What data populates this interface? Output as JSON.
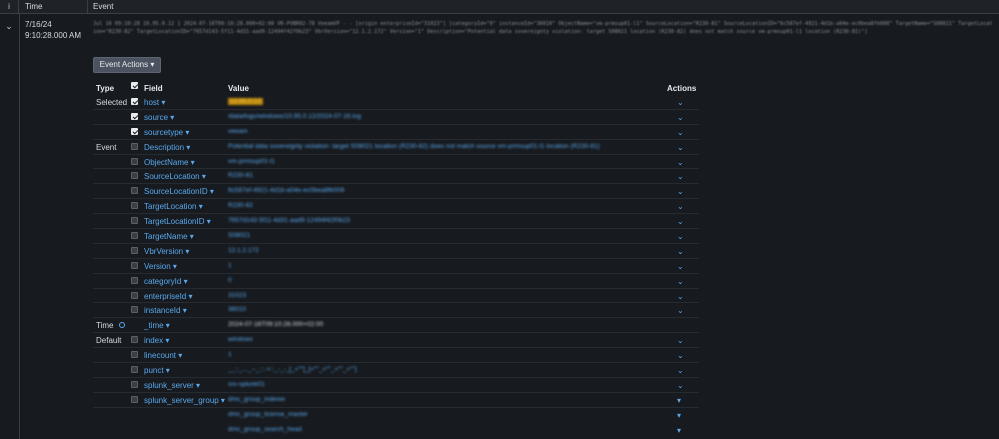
{
  "header": {
    "info_label": "i",
    "time_label": "Time",
    "event_label": "Event"
  },
  "event": {
    "date": "7/16/24",
    "time": "9:10:28.000 AM",
    "raw_text": "Jul 16 09:10:28 10.95.0.12 1 2024-07-16T09:10:28.000+02:00 VR-PVBR02-78 VeeamVP - - [origin enterpriseId=\"31023\"] [categoryId=\"0\" instanceId=\"36010\" ObjectName=\"vm-prmsup01-l1\" SourceLocation=\"R230-81\" SourceLocationID=\"6c587ef-4921-4d1b-a04e-ec0bea8fb008\" TargetName=\"S08021\" TargetLocation=\"R230-82\" TargetLocationID=\"7657d143-5f11-4d31-aad9-12494f42f0b23\" VbrVersion=\"12.1.2.172\" Version=\"1\" Description=\"Potential data sovereignty violation: target S08021 location (R230-82) does not match source vm-prmsup01-l1 location (R230-81)\"]",
    "actions_button": "Event Actions ▾"
  },
  "table": {
    "col_type": "Type",
    "col_field": "Field",
    "col_value": "Value",
    "col_actions": "Actions",
    "rows": [
      {
        "group": "Selected",
        "field": "host ▾",
        "value": "10.95.0.12",
        "checked": true,
        "action": "⌄"
      },
      {
        "group": "",
        "field": "source ▾",
        "value": "/data/logs/windows/10.95.0.12/2024-07-16.log",
        "checked": true,
        "action": "⌄"
      },
      {
        "group": "",
        "field": "sourcetype ▾",
        "value": "veeam",
        "checked": true,
        "action": "⌄"
      },
      {
        "group": "Event",
        "field": "Description ▾",
        "value": "Potential data sovereignty violation: target S08021 location (R230-82) does not match source vm-prmsup01-l1 location (R230-81)",
        "checked": false,
        "action": "⌄"
      },
      {
        "group": "",
        "field": "ObjectName ▾",
        "value": "vm-prmsup01-l1",
        "checked": false,
        "action": "⌄"
      },
      {
        "group": "",
        "field": "SourceLocation ▾",
        "value": "R230-81",
        "checked": false,
        "action": "⌄"
      },
      {
        "group": "",
        "field": "SourceLocationID ▾",
        "value": "6c587ef-4921-4d1b-a04e-ec0bea8fb008",
        "checked": false,
        "action": "⌄"
      },
      {
        "group": "",
        "field": "TargetLocation ▾",
        "value": "R230-82",
        "checked": false,
        "action": "⌄"
      },
      {
        "group": "",
        "field": "TargetLocationID ▾",
        "value": "7657d143-5f11-4d31-aad9-12494f42f0b23",
        "checked": false,
        "action": "⌄"
      },
      {
        "group": "",
        "field": "TargetName ▾",
        "value": "S08021",
        "checked": false,
        "action": "⌄"
      },
      {
        "group": "",
        "field": "VbrVersion ▾",
        "value": "12.1.2.172",
        "checked": false,
        "action": "⌄"
      },
      {
        "group": "",
        "field": "Version ▾",
        "value": "1",
        "checked": false,
        "action": "⌄"
      },
      {
        "group": "",
        "field": "categoryId ▾",
        "value": "0",
        "checked": false,
        "action": "⌄"
      },
      {
        "group": "",
        "field": "enterpriseId ▾",
        "value": "31023",
        "checked": false,
        "action": "⌄"
      },
      {
        "group": "",
        "field": "instanceId ▾",
        "value": "36010",
        "checked": false,
        "action": "⌄"
      },
      {
        "group": "Time",
        "field": "_time ▾",
        "value": "2024-07-16T09:10:28.000+02:00",
        "checked": null,
        "action": ""
      },
      {
        "group": "Default",
        "field": "index ▾",
        "value": "windows",
        "checked": false,
        "action": "⌄"
      },
      {
        "group": "",
        "field": "linecount ▾",
        "value": "1",
        "checked": false,
        "action": "⌄"
      },
      {
        "group": "",
        "field": "punct ▾",
        "value": "__::_..._--_:::.+::_-_-_[_=\"\"]_[=\"\"_=\"\"_=\"\"_=\"\"]",
        "checked": false,
        "action": "⌄"
      },
      {
        "group": "",
        "field": "splunk_server ▾",
        "value": "srv-splunk01",
        "checked": false,
        "action": "⌄"
      },
      {
        "group": "",
        "field": "splunk_server_group ▾",
        "value": "dmc_group_indexer",
        "checked": false,
        "action": "▾"
      }
    ],
    "extra_values": [
      {
        "value": "dmc_group_license_master",
        "action": "▾"
      },
      {
        "value": "dmc_group_search_head",
        "action": "▾"
      }
    ]
  }
}
